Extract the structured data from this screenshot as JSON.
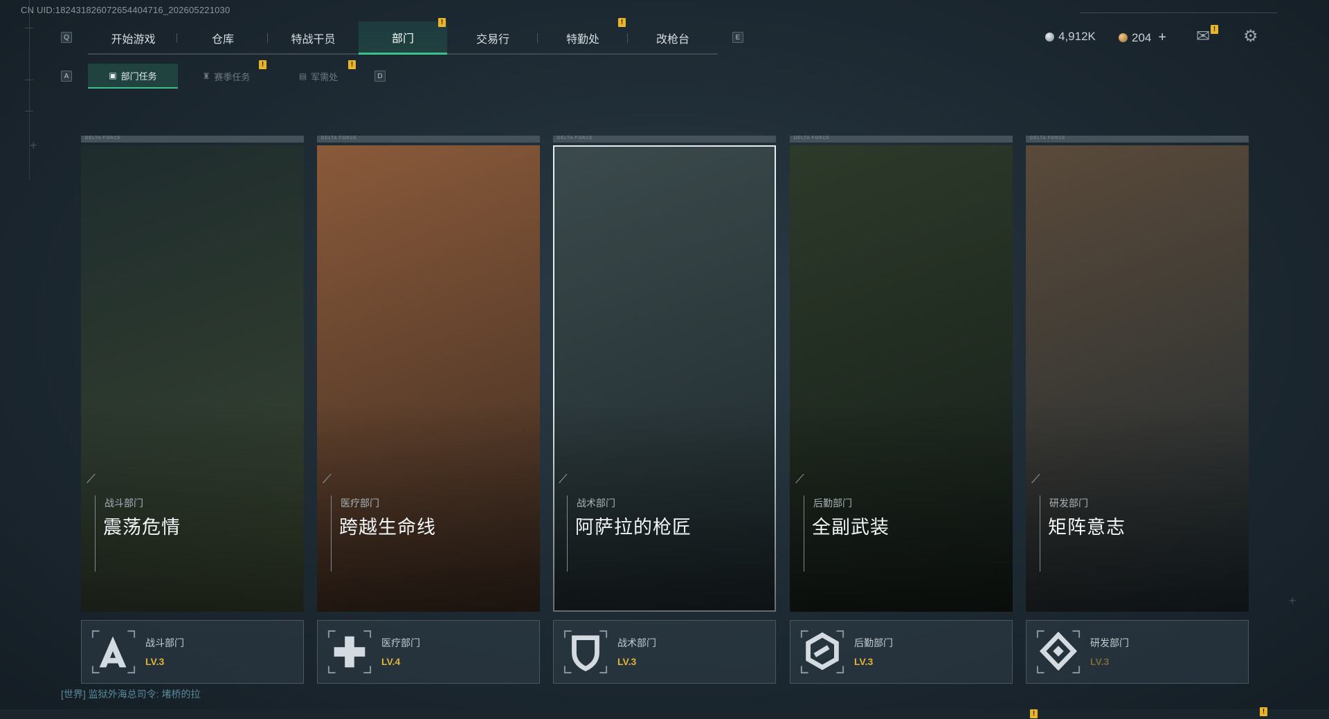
{
  "uid": "CN UID:18243182607265440471​6_202605221030",
  "nav": {
    "key_left": "Q",
    "key_right": "E",
    "items": [
      "开始游戏",
      "仓库",
      "特战干员",
      "部门",
      "交易行",
      "特勤处",
      "改枪台"
    ]
  },
  "subnav": {
    "key_left": "A",
    "key_right": "D",
    "items": [
      "部门任务",
      "赛季任务",
      "军需处"
    ]
  },
  "currency": {
    "coins": "4,912K",
    "tokens": "204",
    "add": "+"
  },
  "alert_mark": "!",
  "cards": [
    {
      "dept": "战斗部门",
      "title": "震荡危情",
      "name": "战斗部门",
      "level": "LV.3",
      "colors": [
        "#1e2c2d",
        "#3a4530"
      ]
    },
    {
      "dept": "医疗部门",
      "title": "跨越生命线",
      "name": "医疗部门",
      "level": "LV.4",
      "colors": [
        "#8a5a3a",
        "#3a2a20"
      ]
    },
    {
      "dept": "战术部门",
      "title": "阿萨拉的枪匠",
      "name": "战术部门",
      "level": "LV.3",
      "colors": [
        "#3b4a4c",
        "#1d282c"
      ]
    },
    {
      "dept": "后勤部门",
      "title": "全副武装",
      "name": "后勤部门",
      "level": "LV.3",
      "colors": [
        "#2d3a2a",
        "#151d18"
      ]
    },
    {
      "dept": "研发部门",
      "title": "矩阵意志",
      "name": "研发部门",
      "level": "LV.3",
      "colors": [
        "#5a4a3a",
        "#1e2a30"
      ]
    }
  ],
  "chat": "[世界] 监狱外海总司令: 堵桥的拉",
  "brand_card_label": "DELTA FORCE"
}
